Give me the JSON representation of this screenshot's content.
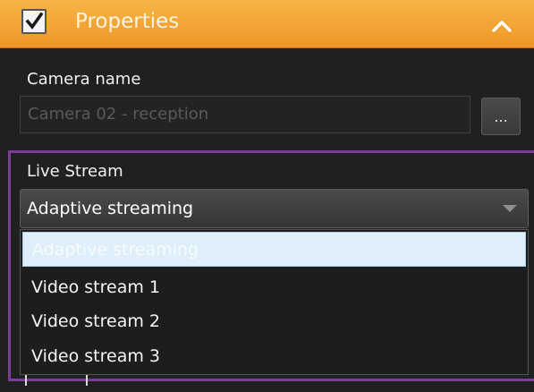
{
  "header": {
    "checked": true,
    "title": "Properties",
    "accent_color": "#f0a030",
    "checkbox_icon": "checkmark-icon",
    "collapse_icon": "chevron-up-icon"
  },
  "camera": {
    "label": "Camera name",
    "value": "Camera 02 - reception",
    "browse_label": "..."
  },
  "stream": {
    "label": "Live Stream",
    "selected": "Adaptive streaming",
    "dropdown_icon": "caret-down-icon",
    "options": [
      {
        "label": "Adaptive streaming",
        "selected": true
      },
      {
        "label": "Video stream 1",
        "selected": false
      },
      {
        "label": "Video stream 2",
        "selected": false
      },
      {
        "label": "Video stream 3",
        "selected": false
      }
    ],
    "highlight_color": "#7b3f97"
  }
}
